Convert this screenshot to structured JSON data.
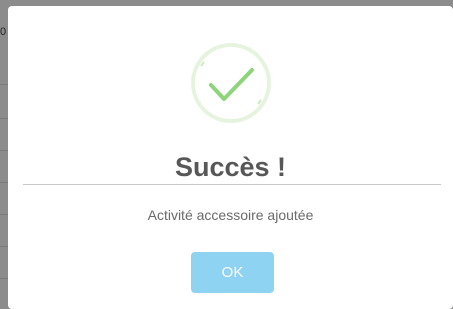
{
  "background": {
    "partial_char": "0"
  },
  "dialog": {
    "icon": "success-checkmark-icon",
    "title": "Succès !",
    "message": "Activité accessoire ajoutée",
    "ok_label": "OK"
  },
  "colors": {
    "check_stroke": "#8dd47a",
    "ring": "#e6f4df",
    "ok_button": "#8fd3f2",
    "title_text": "#575757",
    "message_text": "#6a6a6a",
    "overlay": "#8c8c8c"
  }
}
